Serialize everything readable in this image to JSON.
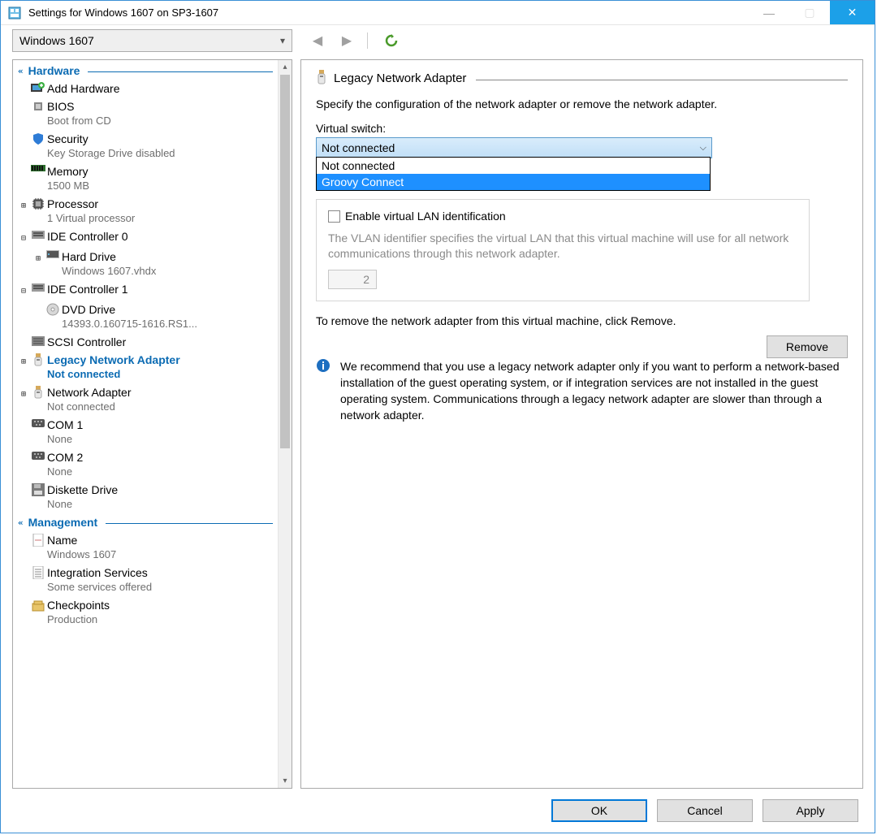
{
  "window": {
    "title": "Settings for Windows 1607 on SP3-1607"
  },
  "topbar": {
    "vm_selected": "Windows 1607"
  },
  "sidebar": {
    "sections": {
      "hardware": "Hardware",
      "management": "Management"
    },
    "items": {
      "add_hw": {
        "label": "Add Hardware"
      },
      "bios": {
        "label": "BIOS",
        "sub": "Boot from CD"
      },
      "security": {
        "label": "Security",
        "sub": "Key Storage Drive disabled"
      },
      "memory": {
        "label": "Memory",
        "sub": "1500 MB"
      },
      "processor": {
        "label": "Processor",
        "sub": "1 Virtual processor"
      },
      "ide0": {
        "label": "IDE Controller 0"
      },
      "hdd": {
        "label": "Hard Drive",
        "sub": "Windows 1607.vhdx"
      },
      "ide1": {
        "label": "IDE Controller 1"
      },
      "dvd": {
        "label": "DVD Drive",
        "sub": "14393.0.160715-1616.RS1..."
      },
      "scsi": {
        "label": "SCSI Controller"
      },
      "legacy_na": {
        "label": "Legacy Network Adapter",
        "sub": "Not connected"
      },
      "na": {
        "label": "Network Adapter",
        "sub": "Not connected"
      },
      "com1": {
        "label": "COM 1",
        "sub": "None"
      },
      "com2": {
        "label": "COM 2",
        "sub": "None"
      },
      "diskette": {
        "label": "Diskette Drive",
        "sub": "None"
      },
      "name": {
        "label": "Name",
        "sub": "Windows 1607"
      },
      "integ": {
        "label": "Integration Services",
        "sub": "Some services offered"
      },
      "checkpoints": {
        "label": "Checkpoints",
        "sub": "Production"
      }
    }
  },
  "panel": {
    "title": "Legacy Network Adapter",
    "description": "Specify the configuration of the network adapter or remove the network adapter.",
    "vs_label": "Virtual switch:",
    "vs_value": "Not connected",
    "dropdown": [
      "Not connected",
      "Groovy Connect"
    ],
    "vlan_chk": "Enable virtual LAN identification",
    "vlan_desc": "The VLAN identifier specifies the virtual LAN that this virtual machine will use for all network communications through this network adapter.",
    "vlan_value": "2",
    "remove_line": "To remove the network adapter from this virtual machine, click Remove.",
    "remove_btn": "Remove",
    "info_text": "We recommend that you use a legacy network adapter only if you want to perform a network-based installation of the guest operating system, or if integration services are not installed in the guest operating system. Communications through a legacy network adapter are slower than through a network adapter."
  },
  "buttons": {
    "ok": "OK",
    "cancel": "Cancel",
    "apply": "Apply"
  }
}
